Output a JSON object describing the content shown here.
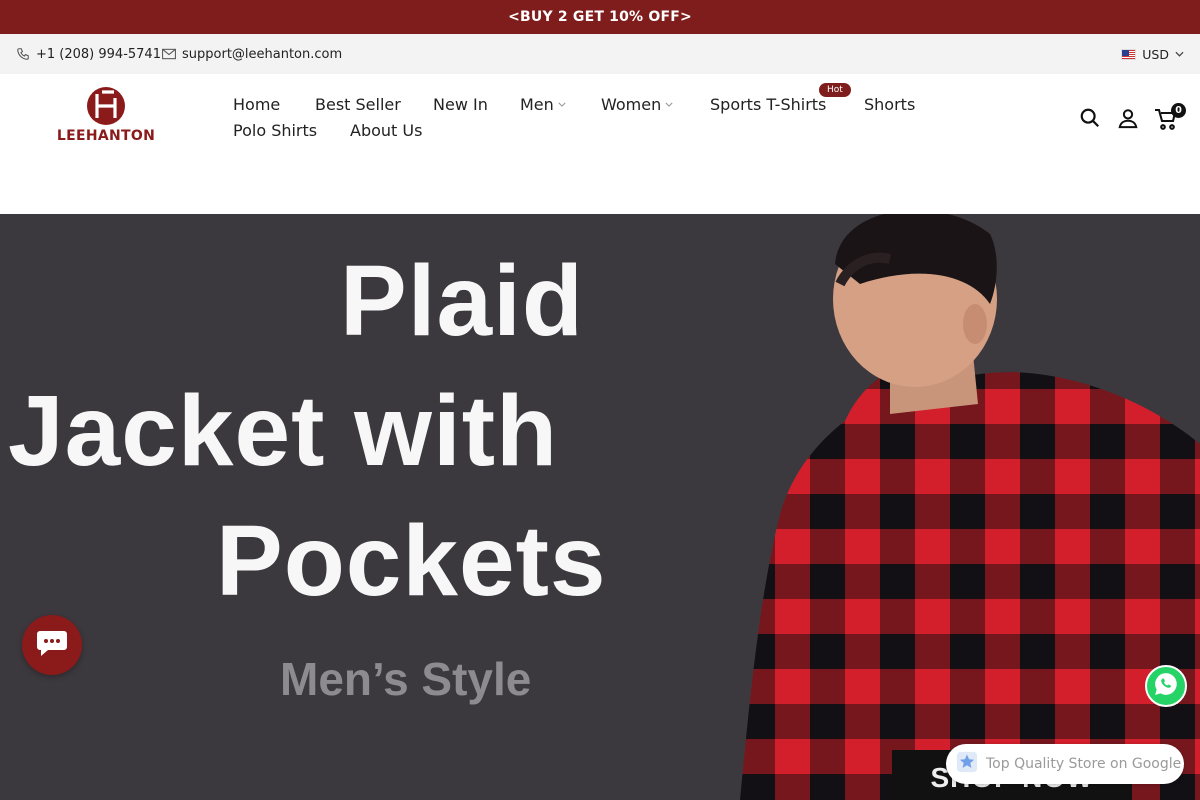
{
  "announcement": "<BUY 2 GET 10% OFF>",
  "topbar": {
    "phone": "+1 (208) 994-5741",
    "email": "support@leehanton.com",
    "currency": "USD"
  },
  "logo": {
    "text": "LEEHANTON"
  },
  "nav": {
    "items": [
      {
        "label": "Home"
      },
      {
        "label": "Best Seller"
      },
      {
        "label": "New In"
      },
      {
        "label": "Men"
      },
      {
        "label": "Women"
      },
      {
        "label": "Sports T-Shirts"
      },
      {
        "label": "Shorts"
      },
      {
        "label": "Polo Shirts"
      },
      {
        "label": "About Us"
      }
    ],
    "hot_badge": "Hot"
  },
  "cart": {
    "count": "0"
  },
  "hero": {
    "line1": "Plaid",
    "line2": "Jacket with",
    "line3": "Pockets",
    "subtitle": "Men’s Style",
    "cta": "SHOP NOW"
  },
  "google_badge": {
    "text": "Top Quality Store on Google"
  },
  "colors": {
    "brand": "#7f1d1d",
    "hero_bg": "#3c393e",
    "whatsapp": "#25d366"
  },
  "icons": [
    "phone-icon",
    "mail-icon",
    "flag-icon",
    "chevron-down-icon",
    "search-icon",
    "user-icon",
    "cart-icon",
    "chat-icon",
    "whatsapp-icon",
    "google-star-icon"
  ]
}
